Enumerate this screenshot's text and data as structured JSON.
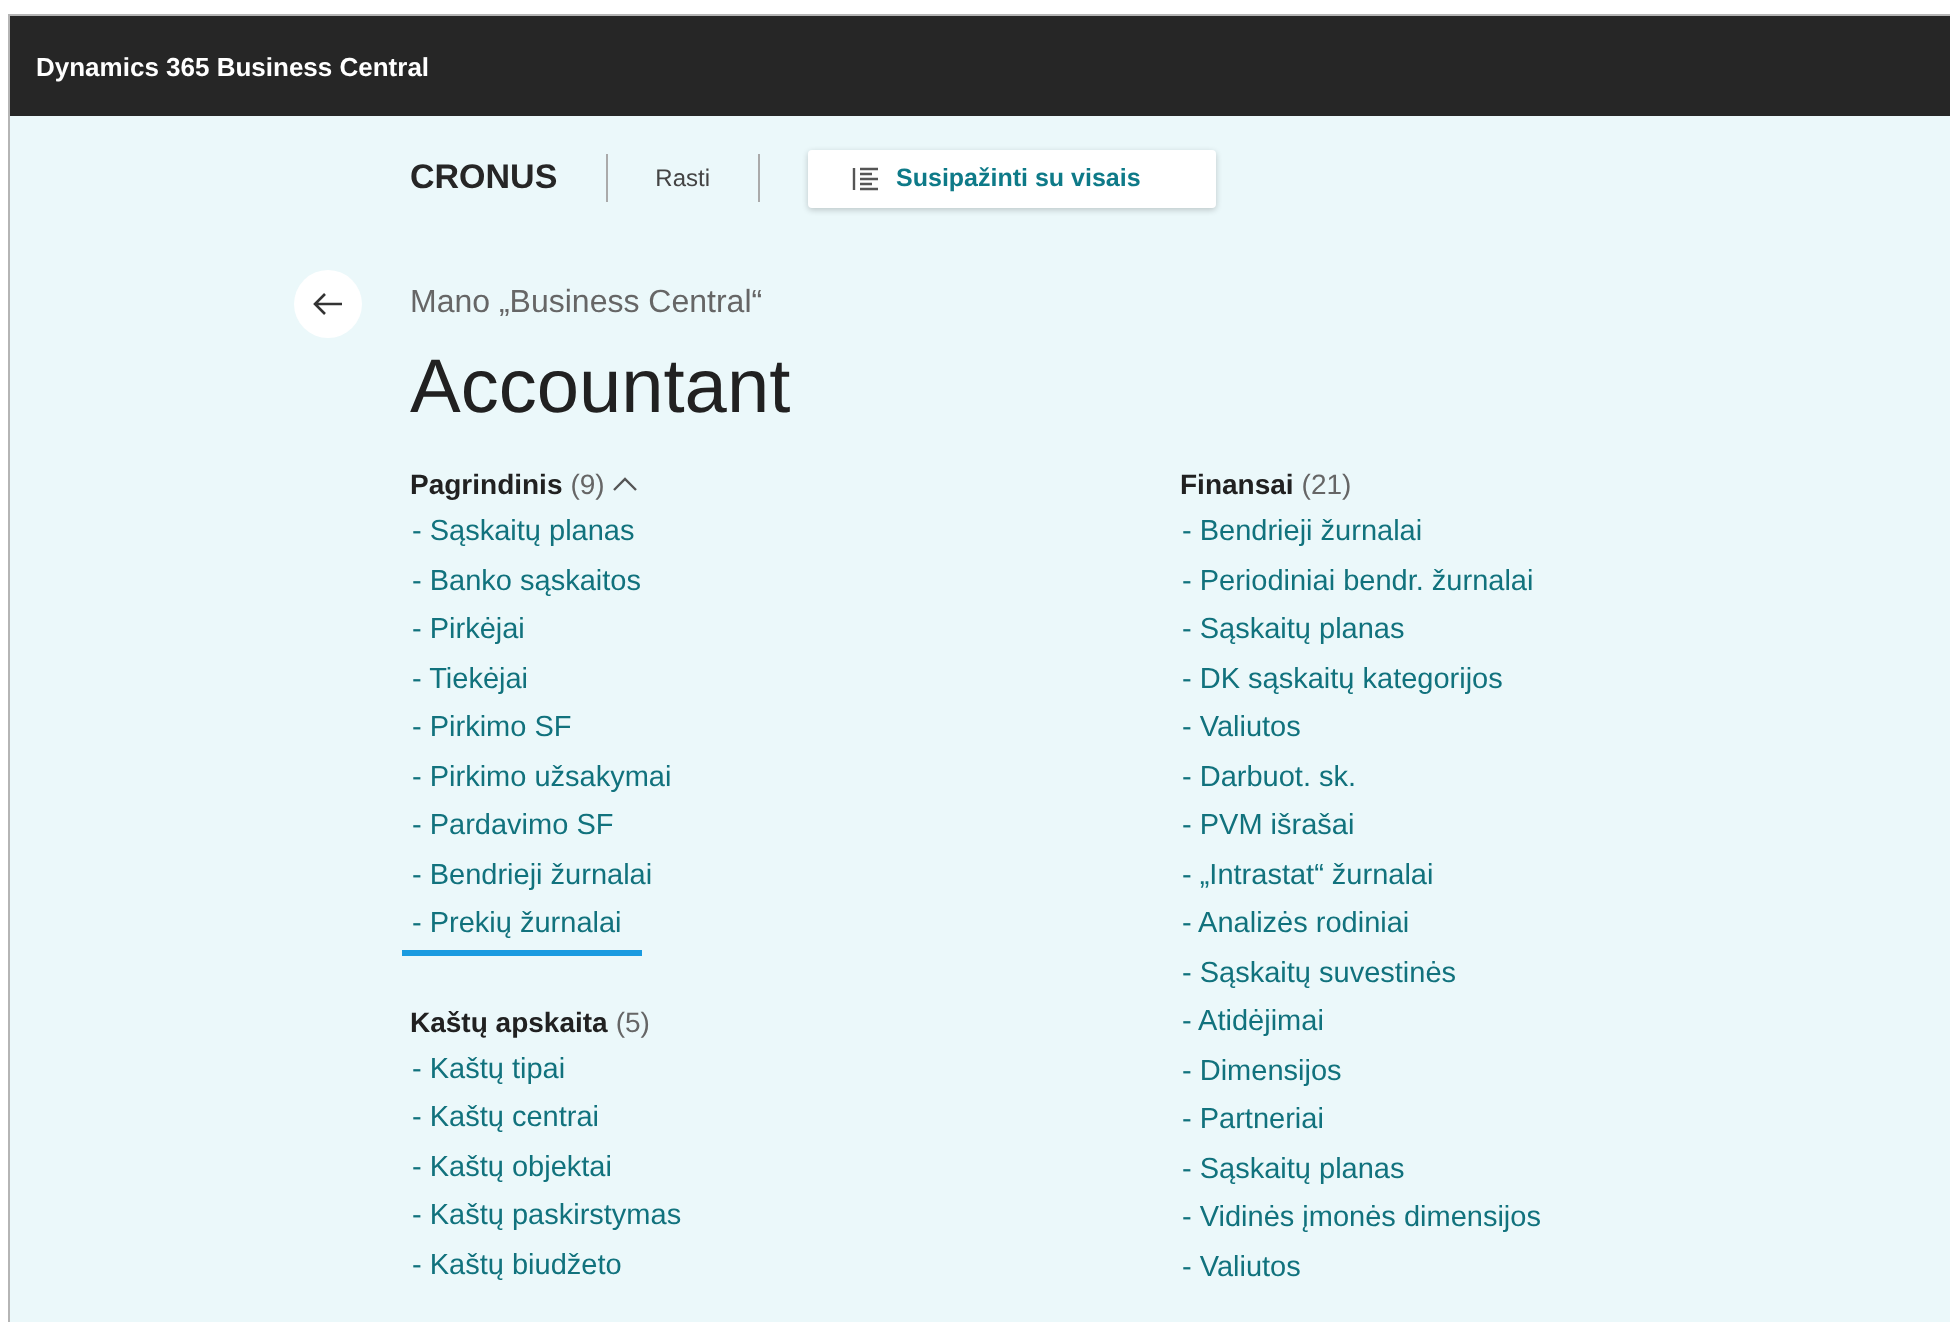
{
  "app_bar": {
    "title": "Dynamics 365 Business Central"
  },
  "header": {
    "company": "CRONUS",
    "search_link": "Rasti",
    "explore_button": "Susipažinti su visais"
  },
  "breadcrumb": "Mano „Business Central“",
  "page_title": "Accountant",
  "columns": [
    [
      {
        "title": "Pagrindinis",
        "count": "(9)",
        "expanded": true,
        "items": [
          {
            "label": "- Sąskaitų planas",
            "focused": false
          },
          {
            "label": "- Banko sąskaitos",
            "focused": false
          },
          {
            "label": "- Pirkėjai",
            "focused": false
          },
          {
            "label": "- Tiekėjai",
            "focused": false
          },
          {
            "label": "- Pirkimo SF",
            "focused": false
          },
          {
            "label": "- Pirkimo užsakymai",
            "focused": false
          },
          {
            "label": "- Pardavimo SF",
            "focused": false
          },
          {
            "label": "- Bendrieji žurnalai",
            "focused": false
          },
          {
            "label": "- Prekių žurnalai",
            "focused": true
          }
        ]
      },
      {
        "title": "Kaštų apskaita",
        "count": "(5)",
        "items": [
          {
            "label": "- Kaštų tipai",
            "focused": false
          },
          {
            "label": "- Kaštų centrai",
            "focused": false
          },
          {
            "label": "- Kaštų objektai",
            "focused": false
          },
          {
            "label": "- Kaštų paskirstymas",
            "focused": false
          },
          {
            "label": "- Kaštų biudžeto",
            "focused": false
          }
        ]
      }
    ],
    [
      {
        "title": "Finansai",
        "count": "(21)",
        "items": [
          {
            "label": "- Bendrieji žurnalai",
            "focused": false
          },
          {
            "label": "- Periodiniai bendr. žurnalai",
            "focused": false
          },
          {
            "label": "- Sąskaitų planas",
            "focused": false
          },
          {
            "label": "- DK sąskaitų kategorijos",
            "focused": false
          },
          {
            "label": "- Valiutos",
            "focused": false
          },
          {
            "label": "- Darbuot. sk.",
            "focused": false
          },
          {
            "label": "- PVM išrašai",
            "focused": false
          },
          {
            "label": "- „Intrastat“ žurnalai",
            "focused": false
          },
          {
            "label": "- Analizės rodiniai",
            "focused": false
          },
          {
            "label": "- Sąskaitų suvestinės",
            "focused": false
          },
          {
            "label": "- Atidėjimai",
            "focused": false
          },
          {
            "label": "- Dimensijos",
            "focused": false
          },
          {
            "label": "- Partneriai",
            "focused": false
          },
          {
            "label": "- Sąskaitų planas",
            "focused": false
          },
          {
            "label": "- Vidinės įmonės dimensijos",
            "focused": false
          },
          {
            "label": "- Valiutos",
            "focused": false
          }
        ]
      }
    ]
  ]
}
